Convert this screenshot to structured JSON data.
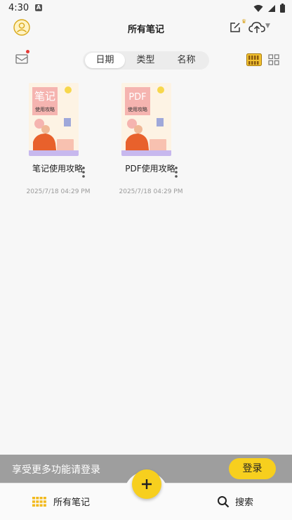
{
  "status_bar": {
    "time": "4:30",
    "notification_letter": "A"
  },
  "header": {
    "title": "所有笔记"
  },
  "sort_tabs": [
    {
      "label": "日期",
      "active": true
    },
    {
      "label": "类型",
      "active": false
    },
    {
      "label": "名称",
      "active": false
    }
  ],
  "notes": [
    {
      "title": "笔记使用攻略",
      "date": "2025/7/18 04:29 PM",
      "cover_heading": "笔记",
      "cover_sub": "使用攻略"
    },
    {
      "title": "PDF使用攻略",
      "date": "2025/7/18 04:29 PM",
      "cover_heading": "PDF",
      "cover_sub": "使用攻略"
    }
  ],
  "login_banner": {
    "text": "享受更多功能请登录",
    "button": "登录"
  },
  "bottom_nav": {
    "all_notes": "所有笔记",
    "search": "搜索"
  },
  "colors": {
    "accent": "#f7cf1e",
    "banner": "#9e9e9e",
    "alert_dot": "#e53935"
  },
  "icons": [
    "avatar-icon",
    "edit-icon",
    "crown-icon",
    "cloud-upload-icon",
    "mail-icon",
    "bookshelf-icon",
    "grid-icon",
    "more-icon",
    "apps-icon",
    "search-icon",
    "plus-icon"
  ]
}
